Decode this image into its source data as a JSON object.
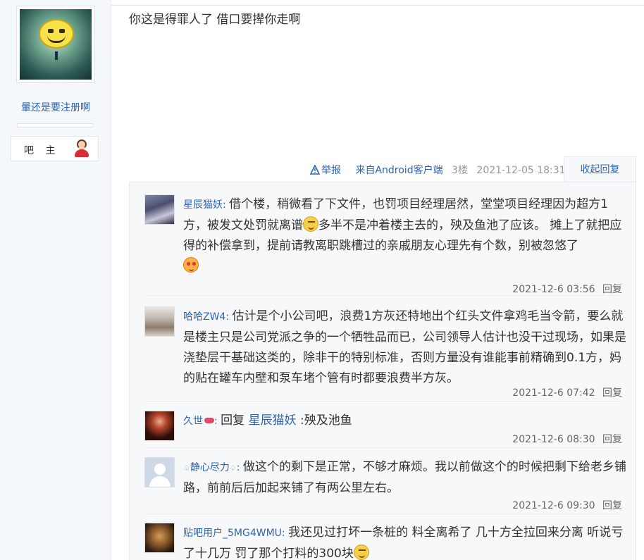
{
  "left_panel": {
    "username": "暈还是要注册啊",
    "role": "吧 主"
  },
  "post": {
    "text": "你这是得罪人了 借口要撵你走啊",
    "meta": {
      "report_label": "举报",
      "from": "来自Android客户端",
      "floor": "3楼",
      "time": "2021-12-05 18:31",
      "collapse_label": "收起回复"
    }
  },
  "replies": [
    {
      "user": "星辰猫妖",
      "text_a": "借个楼，稍微看了下文件，也罚项目经理居然，堂堂项目经理因为超方1方，被发文处罚就离谱",
      "text_b": "多半不是冲着楼主去的，殃及鱼池了应该。 摊上了就把应得的补偿拿到，提前请教离职跳槽过的亲戚朋友心理先有个数，别被忽悠了",
      "time": "2021-12-6 03:56",
      "reply_label": "回复"
    },
    {
      "user": "哈哈ZW4",
      "text_a": "估计是个小公司吧，浪费1方灰还特地出个红头文件拿鸡毛当令箭，要么就是楼主只是公司党派之争的一个牺牲品而已，公司领导人估计也没干过现场，如果是浇垫层干基础这类的，除非干的特别标准，否则方量没有谁能事前精确到0.1方，妈的贴在罐车内壁和泵车堵个管有时都要浪费半方灰。",
      "time": "2021-12-6 07:42",
      "reply_label": "回复"
    },
    {
      "user": "久世",
      "prefix": "回复",
      "quote_user": "星辰猫妖",
      "text_a": ":殃及池鱼",
      "time": "2021-12-6 08:30",
      "reply_label": "回复"
    },
    {
      "user": "静心尽力",
      "text_a": "做这个的剩下是正常，不够才麻烦。我以前做这个的时候把剩下给老乡铺路，前前后后加起来铺了有两公里左右。",
      "time": "2021-12-6 09:30",
      "reply_label": "回复"
    },
    {
      "user": "贴吧用户_5MG4WMU",
      "text_a": "我还见过打坏一条桩的 料全离希了 几十方全拉回来分离 听说亏了十几万 罚了那个打料的300块"
    }
  ],
  "colors": {
    "link": "#2d64b3",
    "panel_bg": "#f7f8fa",
    "left_bg": "#f5f8fa"
  }
}
